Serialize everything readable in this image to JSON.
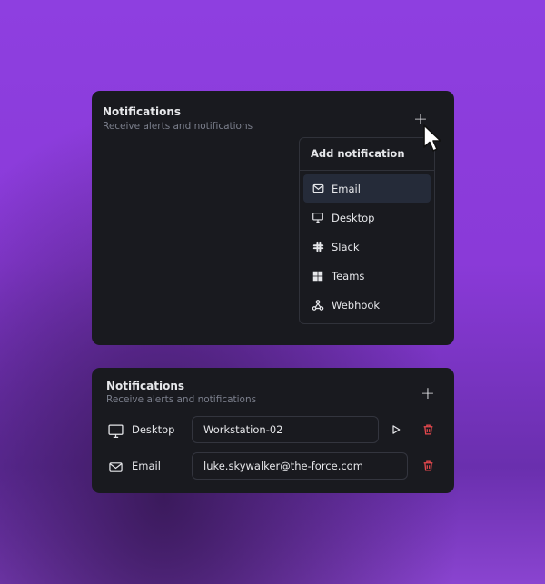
{
  "card_top": {
    "title": "Notifications",
    "subtitle": "Receive alerts and notifications",
    "add_button": "+",
    "dropdown": {
      "header": "Add notification",
      "items": [
        {
          "label": "Email",
          "icon": "mail-icon",
          "active": true
        },
        {
          "label": "Desktop",
          "icon": "monitor-icon"
        },
        {
          "label": "Slack",
          "icon": "slack-icon"
        },
        {
          "label": "Teams",
          "icon": "teams-icon"
        },
        {
          "label": "Webhook",
          "icon": "webhook-icon"
        }
      ]
    }
  },
  "card_bottom": {
    "title": "Notifications",
    "subtitle": "Receive alerts and notifications",
    "add_button": "+",
    "rows": [
      {
        "label": "Desktop",
        "icon": "monitor-icon",
        "value": "Workstation-02"
      },
      {
        "label": "Email",
        "icon": "mail-icon",
        "value": "luke.skywalker@the-force.com"
      }
    ]
  },
  "colors": {
    "card_bg": "#191a1f",
    "active_item_bg": "#252b39",
    "delete_red": "#e5484d",
    "text": "#e6e7ea",
    "muted": "#7b7f8c"
  }
}
